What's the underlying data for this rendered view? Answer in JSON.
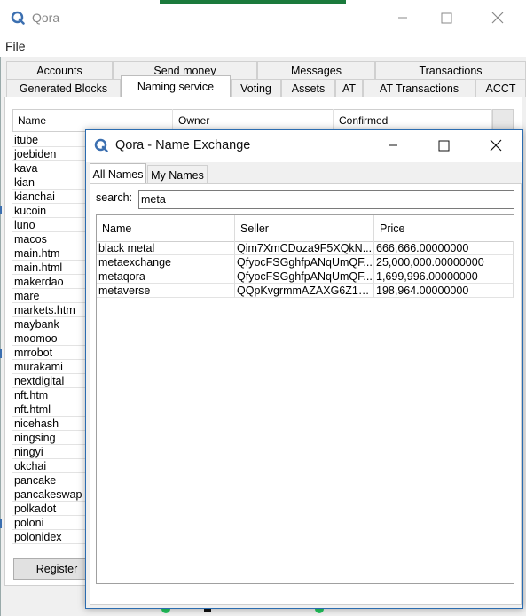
{
  "main_window": {
    "title": "Qora",
    "menu": {
      "file_label": "File"
    },
    "tabs_row1": [
      "Accounts",
      "Send money",
      "Messages",
      "Transactions"
    ],
    "tabs_row2": [
      "Generated Blocks",
      "Naming service",
      "Voting",
      "Assets",
      "AT",
      "AT Transactions",
      "ACCT"
    ],
    "active_tab": "Naming service",
    "names_table": {
      "columns": [
        "Name",
        "Owner",
        "Confirmed"
      ],
      "rows": [
        "itube",
        "joebiden",
        "kava",
        "kian",
        "kianchai",
        "kucoin",
        "luno",
        "macos",
        "main.htm",
        "main.html",
        "makerdao",
        "mare",
        "markets.htm",
        "maybank",
        "moomoo",
        "mrrobot",
        "murakami",
        "nextdigital",
        "nft.htm",
        "nft.html",
        "nicehash",
        "ningsing",
        "ningyi",
        "okchai",
        "pancake",
        "pancakeswap",
        "polkadot",
        "poloni",
        "polonidex"
      ]
    },
    "register_button": "Register"
  },
  "dialog": {
    "title": "Qora - Name Exchange",
    "tabs": [
      "All Names",
      "My Names"
    ],
    "active_tab": "All Names",
    "search": {
      "label": "search:",
      "value": "meta"
    },
    "columns": [
      "Name",
      "Seller",
      "Price"
    ],
    "rows": [
      {
        "name": "black metal",
        "seller": "Qim7XmCDoza9F5XQkN...",
        "price": "666,666.00000000"
      },
      {
        "name": "metaexchange",
        "seller": "QfyocFSGghfpANqUmQF...",
        "price": "25,000,000.00000000"
      },
      {
        "name": "metaqora",
        "seller": "QfyocFSGghfpANqUmQF...",
        "price": "1,699,996.00000000"
      },
      {
        "name": "metaverse",
        "seller": "QQpKvgrmmAZAXG6Z1b...",
        "price": "198,964.00000000"
      }
    ]
  },
  "colors": {
    "accent_border": "#2b6cb0",
    "status_green": "#22c55e",
    "strip_green": "#1b7a3c"
  }
}
